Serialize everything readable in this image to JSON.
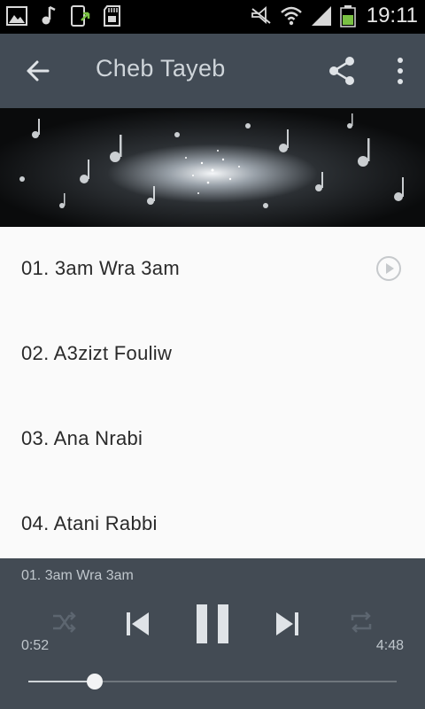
{
  "status_bar": {
    "time": "19:11",
    "icons_left": [
      "gallery-icon",
      "music-note-icon",
      "download-phone-icon",
      "sd-card-icon"
    ],
    "icons_right": [
      "signal-muted-icon",
      "wifi-icon",
      "cell-signal-icon",
      "battery-icon"
    ]
  },
  "app_bar": {
    "title": "Cheb Tayeb",
    "back_icon": "arrow-left-icon",
    "share_icon": "share-icon",
    "more_icon": "more-vert-icon"
  },
  "tracks": [
    {
      "label": "01. 3am Wra 3am",
      "playing": true
    },
    {
      "label": "02. A3zizt Fouliw",
      "playing": false
    },
    {
      "label": "03. Ana Nrabi",
      "playing": false
    },
    {
      "label": "04. Atani Rabbi",
      "playing": false
    }
  ],
  "player": {
    "now_playing": "01. 3am Wra 3am",
    "elapsed": "0:52",
    "duration": "4:48",
    "progress_fraction": 0.18,
    "controls": [
      "shuffle-icon",
      "previous-icon",
      "pause-icon",
      "next-icon",
      "repeat-icon"
    ]
  },
  "colors": {
    "app_bar": "#424b55",
    "player": "#434b54",
    "list_bg": "#fafafa",
    "status_bar": "#000000"
  }
}
